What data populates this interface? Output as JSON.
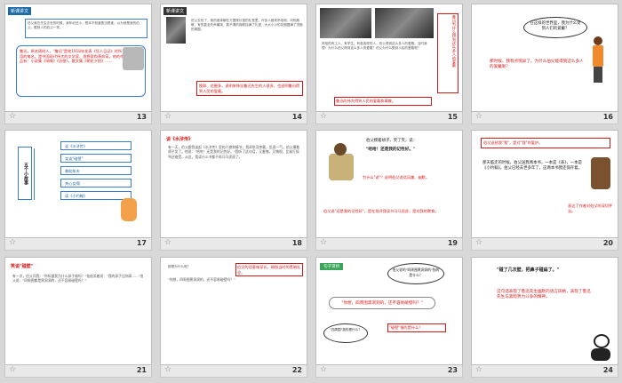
{
  "slides": [
    {
      "num": "13",
      "tag": "新课讲文",
      "lead": "伯父就在先生去世的时候，我年纪还小，根本不知道鲁迅是谁，以为他是我的伯父，跟别人的伯父一样。",
      "quote": "鲁迅，原名周树人，\"鲁迅\"是他1918年发表《狂人日记》时所用的笔名。是中国现代伟大的文学家、思想家和革命家。他的作品有：小说集《呐喊》《彷徨》，散文集《朝花夕拾》……",
      "highlight": "鲁迅"
    },
    {
      "num": "14",
      "text": "伯父去世了，他的遗体躺在万国殡仪馆的礼堂里，许多人都来吊唁他，向他致敬，有的甚至失声痛哭，数不清的挽联挂满了礼堂，大大小小的花圈摆满了灵柩的周围。",
      "red": "挽联、花圈多，说明来悼念鲁迅先生的人很多，也说明鲁迅得到人民的爱戴。"
    },
    {
      "num": "15",
      "text": "吊唁的有工人、有学生，有各各样的人，伯父得到这么多人的爱戴。当时我想：为什么伯父得到这么多人的爱戴？伯父为什么受到人民的爱戴呢？",
      "side": "鲁迅为什么得到这么多人的爱戴",
      "bottom": "鲁迅的伟大得到人民的爱戴和尊敬。"
    },
    {
      "num": "16",
      "bubble": "在这样的世界里，我为什么受到人们的爱戴？",
      "question": "那时候，我有点惊异了。为什么伯父能得到这么多人的爱戴呢？"
    },
    {
      "num": "17",
      "title": "五个小故事",
      "items": [
        "谈《水浒传》",
        "笑谈\"碰壁\"",
        "救助车夫",
        "关心女佣",
        "读《小约翰》"
      ]
    },
    {
      "num": "18",
      "heading": "谈《水浒传》",
      "body": "有一天，伯父跟我谈起《水浒传》里的人物和情节，我却张冠李戴，乱说一气。伯父摸着胡子笑了。他说：\"哈哈！还是我的记性好。\"我听了这句话，又羞愧，又悔恨，比挨打挨骂还难受。从此，我读什么书都不再马马虎虎了。"
    },
    {
      "num": "19",
      "line1": "伯父摸着胡子，笑了笑，说：",
      "line2": "\"哈哈！还是我的记性好。\"",
      "red1": "为什么\"说\"？说明伯父说话风趣、幽默。",
      "red2": "伯父说\"还是我的记性好\"，是在批评我读书马马虎虎，是对我的教育。"
    },
    {
      "num": "20",
      "top": "伯父送给我\"我\"，是对\"我\"的爱护。",
      "body": "那天临走的时候，伯父送我两本书，一本是《表》，一本是《小约翰》。伯父已经去世多年了，这两本书我还保存着。",
      "aside": "表达了作者对伯父的深切怀念。"
    },
    {
      "num": "21",
      "heading": "笑谈\"碰壁\"",
      "body": "有一次，伯父问我：\"你知道我为什么鼻子扁吗？\"爸爸笑着说：\"我的鼻子比你高……\"伯父说：\"四周围都是黑洞洞的，还不容易碰壁吗？\""
    },
    {
      "num": "22",
      "q1": "那是为什么呢？",
      "ans": "\"你想，四周围黑洞洞的，还不容易碰壁吗？\"",
      "red": "伯父的话意味深长，暗指当时的黑暗社会。"
    },
    {
      "num": "23",
      "label": "句子赏析",
      "bubble": "伯父说的\"四周围黑洞洞的\"指的是什么？",
      "center": "\"你想，四周围黑洞洞的，还不容易碰壁吗？\"",
      "left": "\"四周围\"指的是什么？",
      "right": "\"碰壁\"指的是什么？"
    },
    {
      "num": "24",
      "quote": "\"碰了几次壁，把鼻子碰扁了。\"",
      "red": "这句话表现了鲁迅先生幽默的语言风格，表现了鲁迅先生与黑暗势力斗争的精神。"
    }
  ]
}
